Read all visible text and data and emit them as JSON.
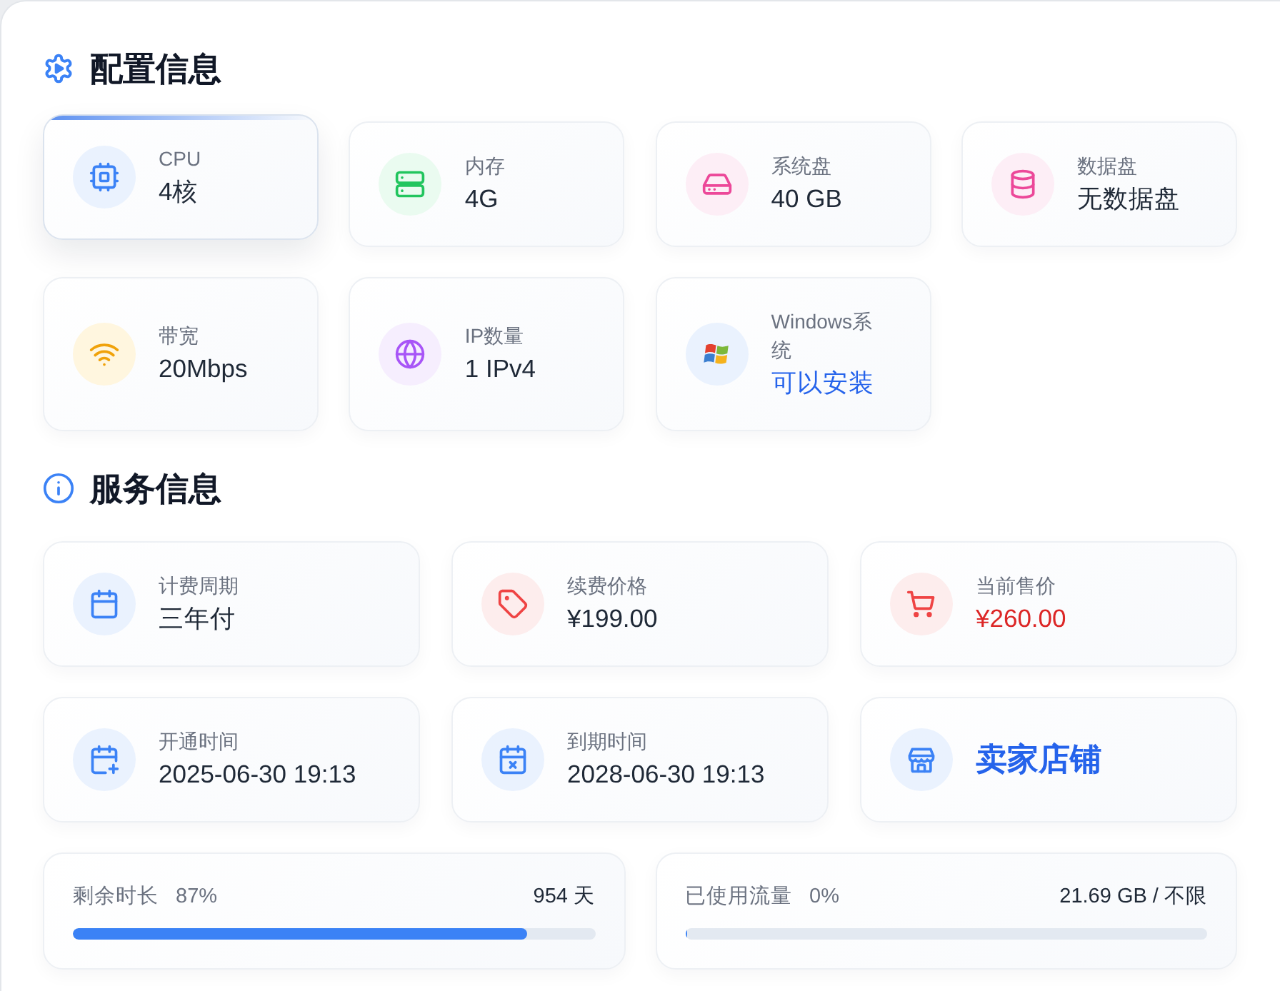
{
  "config": {
    "title": "配置信息",
    "items": [
      {
        "kind": "stat",
        "label": "CPU",
        "value": "4核",
        "highlighted": true
      },
      {
        "kind": "stat",
        "label": "内存",
        "value": "4G",
        "highlighted": false
      },
      {
        "kind": "stat",
        "label": "系统盘",
        "value": "40 GB",
        "highlighted": false
      },
      {
        "kind": "stat",
        "label": "数据盘",
        "value": "无数据盘",
        "highlighted": false
      },
      {
        "kind": "stat",
        "label": "带宽",
        "value": "20Mbps",
        "highlighted": false
      },
      {
        "kind": "stat",
        "label": "IP数量",
        "value": "1 IPv4",
        "highlighted": false
      },
      {
        "kind": "status",
        "label": "Windows系统",
        "value": "可以安装",
        "highlighted": false
      }
    ]
  },
  "service": {
    "title": "服务信息",
    "items": [
      {
        "kind": "stat",
        "label": "计费周期",
        "value": "三年付"
      },
      {
        "kind": "stat",
        "label": "续费价格",
        "value": "¥199.00"
      },
      {
        "kind": "price",
        "label": "当前售价",
        "value": "¥260.00"
      },
      {
        "kind": "stat",
        "label": "开通时间",
        "value": "2025-06-30 19:13"
      },
      {
        "kind": "stat",
        "label": "到期时间",
        "value": "2028-06-30 19:13"
      },
      {
        "kind": "link",
        "text": "卖家店铺"
      }
    ]
  },
  "usage": [
    {
      "label": "剩余时长",
      "percent": "87%",
      "reading": "954 天",
      "level": 0.87
    },
    {
      "label": "已使用流量",
      "percent": "0%",
      "reading": "21.69 GB / 不限",
      "level": 0
    }
  ]
}
